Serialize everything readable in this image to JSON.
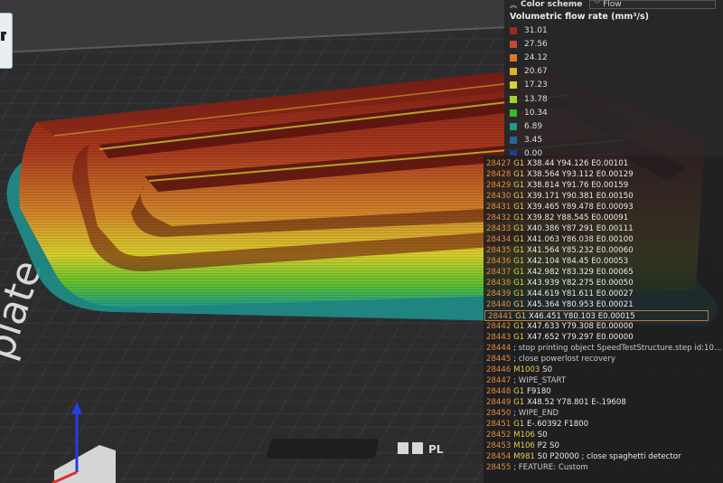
{
  "color_scheme": {
    "label": "Color scheme",
    "selected": "Flow",
    "expand_icon": "double-chevron-up-icon",
    "dropdown_icon": "chevron-down-icon"
  },
  "legend": {
    "title": "Volumetric flow rate (mm³/s)",
    "items": [
      {
        "value": "31.01",
        "color": "#9b2a1e"
      },
      {
        "value": "27.56",
        "color": "#c8492a"
      },
      {
        "value": "24.12",
        "color": "#d9792d"
      },
      {
        "value": "20.67",
        "color": "#e0b028"
      },
      {
        "value": "17.23",
        "color": "#d9d52c"
      },
      {
        "value": "13.78",
        "color": "#9fd62c"
      },
      {
        "value": "10.34",
        "color": "#38b82c"
      },
      {
        "value": "6.89",
        "color": "#1f9a8e"
      },
      {
        "value": "3.45",
        "color": "#21669c"
      },
      {
        "value": "0.00",
        "color": "#1e3f8f"
      }
    ]
  },
  "gcode": {
    "lines": [
      {
        "num": "28427",
        "cmd": "G1",
        "args": "X38.44 Y94.126 E0.00101"
      },
      {
        "num": "28428",
        "cmd": "G1",
        "args": "X38.564 Y93.112 E0.00129"
      },
      {
        "num": "28429",
        "cmd": "G1",
        "args": "X38.814 Y91.76 E0.00159"
      },
      {
        "num": "28430",
        "cmd": "G1",
        "args": "X39.171 Y90.381 E0.00150"
      },
      {
        "num": "28431",
        "cmd": "G1",
        "args": "X39.465 Y89.478 E0.00093"
      },
      {
        "num": "28432",
        "cmd": "G1",
        "args": "X39.82 Y88.545 E0.00091"
      },
      {
        "num": "28433",
        "cmd": "G1",
        "args": "X40.386 Y87.291 E0.00111"
      },
      {
        "num": "28434",
        "cmd": "G1",
        "args": "X41.063 Y86.038 E0.00100"
      },
      {
        "num": "28435",
        "cmd": "G1",
        "args": "X41.564 Y85.232 E0.00060"
      },
      {
        "num": "28436",
        "cmd": "G1",
        "args": "X42.104 Y84.45 E0.00053"
      },
      {
        "num": "28437",
        "cmd": "G1",
        "args": "X42.982 Y83.329 E0.00065"
      },
      {
        "num": "28438",
        "cmd": "G1",
        "args": "X43.939 Y82.275 E0.00050"
      },
      {
        "num": "28439",
        "cmd": "G1",
        "args": "X44.619 Y81.611 E0.00027"
      },
      {
        "num": "28440",
        "cmd": "G1",
        "args": "X45.364 Y80.953 E0.00021"
      },
      {
        "num": "28441",
        "cmd": "G1",
        "args": "X46.451 Y80.103 E0.00015",
        "selected": true
      },
      {
        "num": "28442",
        "cmd": "G1",
        "args": "X47.633 Y79.308 E0.00000"
      },
      {
        "num": "28443",
        "cmd": "G1",
        "args": "X47.652 Y79.297 E0.00000"
      },
      {
        "num": "28444",
        "cmd": "",
        "args": "; stop printing object SpeedTestStructure.step id:10..."
      },
      {
        "num": "28445",
        "cmd": "",
        "args": "; close powerlost recovery"
      },
      {
        "num": "28446",
        "cmd": "M1003",
        "args": "S0"
      },
      {
        "num": "28447",
        "cmd": "",
        "args": "; WIPE_START"
      },
      {
        "num": "28448",
        "cmd": "G1",
        "args": "F9180"
      },
      {
        "num": "28449",
        "cmd": "G1",
        "args": "X48.52 Y78.801 E-.19608"
      },
      {
        "num": "28450",
        "cmd": "",
        "args": "; WIPE_END"
      },
      {
        "num": "28451",
        "cmd": "G1",
        "args": "E-.60392 F1800"
      },
      {
        "num": "28452",
        "cmd": "M106",
        "args": "S0"
      },
      {
        "num": "28453",
        "cmd": "M106",
        "args": "P2 S0"
      },
      {
        "num": "28454",
        "cmd": "M981",
        "args": "S0 P20000 ; close spaghetti detector"
      },
      {
        "num": "28455",
        "cmd": "",
        "args": "; FEATURE: Custom"
      }
    ]
  },
  "plate": {
    "side_text": "plate",
    "logo_text": "PL",
    "logo_glyph": "H"
  }
}
